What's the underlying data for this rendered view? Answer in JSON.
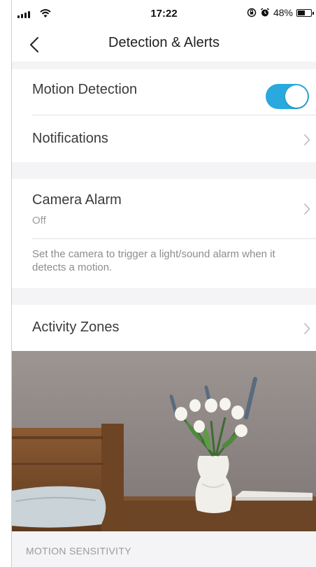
{
  "status_bar": {
    "time": "17:22",
    "battery_text": "48%",
    "battery_level": 0.48
  },
  "nav": {
    "title": "Detection & Alerts",
    "back_icon": "chevron-left-icon"
  },
  "settings": {
    "motion_detection": {
      "label": "Motion Detection",
      "enabled": true
    },
    "notifications": {
      "label": "Notifications"
    },
    "camera_alarm": {
      "label": "Camera Alarm",
      "value": "Off",
      "description": "Set the camera to trigger a light/sound alarm when it detects a motion."
    },
    "activity_zones": {
      "label": "Activity Zones"
    }
  },
  "section": {
    "motion_sensitivity_header": "MOTION SENSITIVITY"
  },
  "colors": {
    "accent": "#2aa9de",
    "group_background": "#f4f4f6"
  }
}
